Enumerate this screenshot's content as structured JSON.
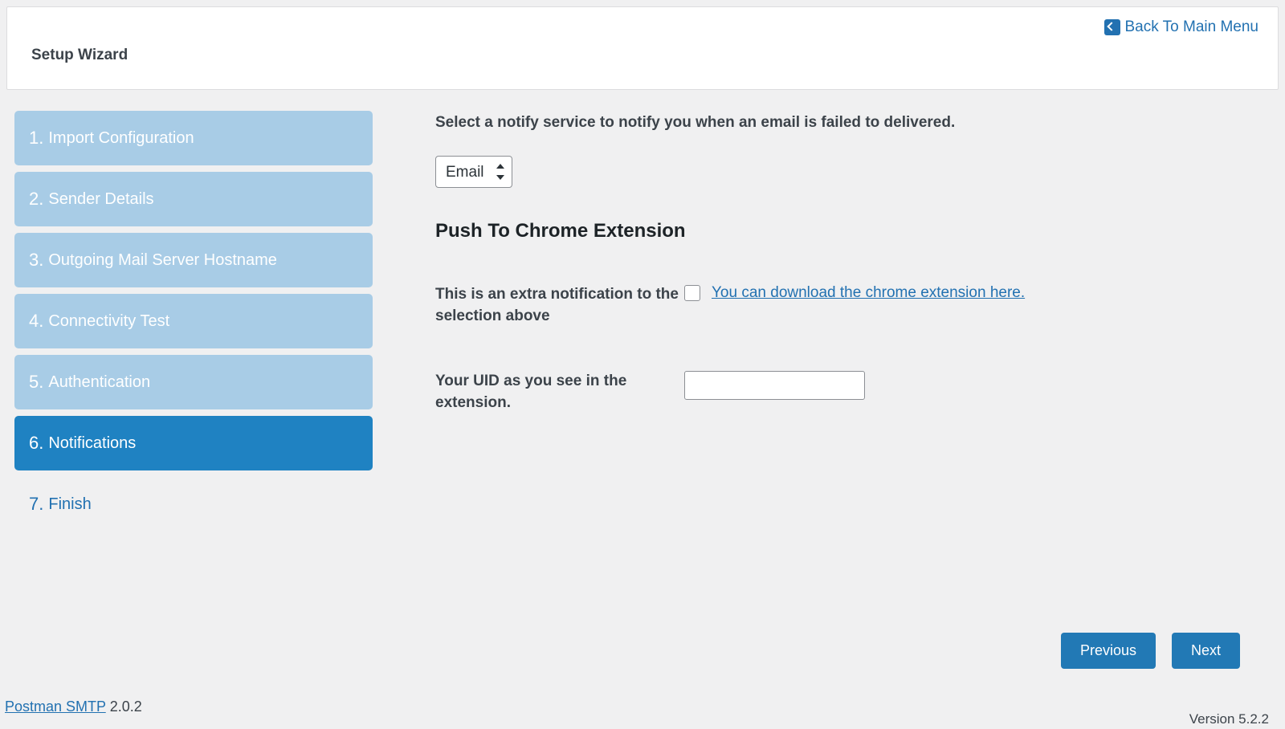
{
  "header": {
    "title": "Setup Wizard",
    "back_label": "Back To Main Menu"
  },
  "steps": [
    {
      "num": "1.",
      "label": "Import Configuration",
      "state": "done"
    },
    {
      "num": "2.",
      "label": "Sender Details",
      "state": "done"
    },
    {
      "num": "3.",
      "label": "Outgoing Mail Server Hostname",
      "state": "done"
    },
    {
      "num": "4.",
      "label": "Connectivity Test",
      "state": "done"
    },
    {
      "num": "5.",
      "label": "Authentication",
      "state": "done"
    },
    {
      "num": "6.",
      "label": "Notifications",
      "state": "active"
    },
    {
      "num": "7.",
      "label": "Finish",
      "state": "pending"
    }
  ],
  "main": {
    "intro": "Select a notify service to notify you when an email is failed to delivered.",
    "notify_select": {
      "selected": "Email",
      "options": [
        "Email"
      ]
    },
    "section_heading": "Push To Chrome Extension",
    "rows": {
      "extra": {
        "label": "This is an extra notification to the selection above",
        "link_text": "You can download the chrome extension here.",
        "checked": false
      },
      "uid": {
        "label": "Your UID as you see in the extension.",
        "value": ""
      }
    }
  },
  "nav": {
    "previous": "Previous",
    "next": "Next"
  },
  "footer": {
    "product_link": "Postman SMTP",
    "product_version": " 2.0.2",
    "wp_version": "Version 5.2.2"
  }
}
